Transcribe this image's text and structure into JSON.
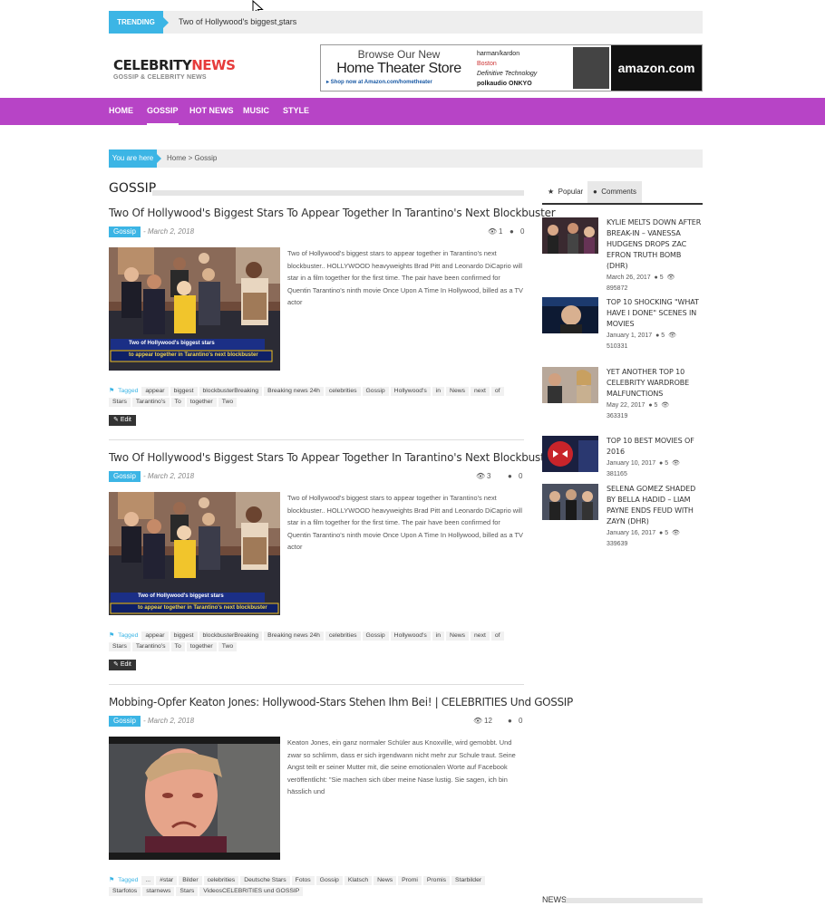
{
  "trending": {
    "label": "TRENDING",
    "text": "Two of Hollywood's biggest stars"
  },
  "logo": {
    "part1": "CELEBRITY",
    "part2": "NEWS",
    "tagline": "GOSSIP & CELEBRITY NEWS"
  },
  "ad": {
    "line1": "Browse Our New",
    "line2": "Home Theater Store",
    "line3": "▸ Shop now at Amazon.com/hometheater",
    "brands": [
      "harman/kardon",
      "Boston",
      "Definitive Technology",
      "polkaudio ONKYO"
    ],
    "amazon": "amazon.com"
  },
  "nav": {
    "items": [
      "HOME",
      "GOSSIP",
      "HOT NEWS",
      "MUSIC",
      "STYLE"
    ],
    "active": "GOSSIP"
  },
  "breadcrumb": {
    "label": "You are here",
    "path": "Home > Gossip"
  },
  "section": {
    "title": "GOSSIP"
  },
  "posts": [
    {
      "title": "Two Of Hollywood's Biggest Stars To Appear Together In Tarantino's Next Blockbuster",
      "category": "Gossip",
      "date": "- March 2, 2018",
      "views": "1",
      "comments": "0",
      "excerpt": "Two of Hollywood's biggest stars to appear together in Tarantino's next blockbuster.. HOLLYWOOD heavyweights Brad Pitt and Leonardo DiCaprio will star in a film together for the first time. The pair have been confirmed for Quentin Tarantino's ninth movie Once Upon A Time In Hollywood, billed as a TV actor",
      "caption1": "Two of Hollywood's biggest stars",
      "caption2": "to appear together in Tarantino's next blockbuster",
      "tag_label": "Tagged",
      "tags": [
        "appear",
        "biggest",
        "blockbusterBreaking",
        "Breaking news 24h",
        "celebrities",
        "Gossip",
        "Hollywood's",
        "in",
        "News",
        "next",
        "of",
        "Stars",
        "Tarantino's",
        "To",
        "together",
        "Two"
      ],
      "edit": "Edit"
    },
    {
      "title": "Two Of Hollywood's Biggest Stars To Appear Together In Tarantino's Next Blockbuster",
      "category": "Gossip",
      "date": "- March 2, 2018",
      "views": "3",
      "comments": "0",
      "excerpt": "Two of Hollywood's biggest stars to appear together in Tarantino's next blockbuster.. HOLLYWOOD heavyweights Brad Pitt and Leonardo DiCaprio will star in a film together for the first time. The pair have been confirmed for Quentin Tarantino's ninth movie Once Upon A Time In Hollywood, billed as a TV actor",
      "caption1": "Two of Hollywood's biggest stars",
      "caption2": "to appear together in Tarantino's next blockbuster",
      "tag_label": "Tagged",
      "tags": [
        "appear",
        "biggest",
        "blockbusterBreaking",
        "Breaking news 24h",
        "celebrities",
        "Gossip",
        "Hollywood's",
        "in",
        "News",
        "next",
        "of",
        "Stars",
        "Tarantino's",
        "To",
        "together",
        "Two"
      ],
      "edit": "Edit"
    },
    {
      "title": "Mobbing-Opfer Keaton Jones: Hollywood-Stars Stehen Ihm Bei! | CELEBRITIES Und GOSSIP",
      "category": "Gossip",
      "date": "- March 2, 2018",
      "views": "12",
      "comments": "0",
      "excerpt": "Keaton Jones, ein ganz normaler Schüler aus Knoxville, wird gemobbt. Und zwar so schlimm, dass er sich irgendwann nicht mehr zur Schule traut. Seine Angst teilt er seiner Mutter mit, die seine emotionalen Worte auf Facebook veröffentlicht: \"Sie machen sich über meine Nase lustig. Sie sagen, ich bin hässlich und",
      "tag_label": "Tagged",
      "tags": [
        "...",
        "#star",
        "Bilder",
        "celebrities",
        "Deutsche Stars",
        "Fotos",
        "Gossip",
        "Klatsch",
        "News",
        "Promi",
        "Promis",
        "Starbilder",
        "Starfotos",
        "starnews",
        "Stars",
        "VideosCELEBRITIES und GOSSIP"
      ]
    }
  ],
  "sidebar": {
    "tabs": [
      "Popular",
      "Comments"
    ],
    "items": [
      {
        "title": "KYLIE MELTS DOWN AFTER BREAK-IN – VANESSA HUDGENS DROPS ZAC EFRON TRUTH BOMB (DHR)",
        "date": "March 26, 2017",
        "comments": "5",
        "views": "895872"
      },
      {
        "title": "TOP 10 SHOCKING \"WHAT HAVE I DONE\" SCENES IN MOVIES",
        "date": "January 1, 2017",
        "comments": "5",
        "views": "510331"
      },
      {
        "title": "YET ANOTHER TOP 10 CELEBRITY WARDROBE MALFUNCTIONS",
        "date": "May 22, 2017",
        "comments": "5",
        "views": "363319"
      },
      {
        "title": "TOP 10 BEST MOVIES OF 2016",
        "date": "January 10, 2017",
        "comments": "5",
        "views": "381165"
      },
      {
        "title": "SELENA GOMEZ SHADED BY BELLA HADID – LIAM PAYNE ENDS FEUD WITH ZAYN (DHR)",
        "date": "January 16, 2017",
        "comments": "5",
        "views": "339639"
      }
    ],
    "news_heading": "NEWS"
  },
  "colors": {
    "accent": "#3cb5e5",
    "nav": "#b744c6",
    "logo_red": "#e63b3b"
  }
}
